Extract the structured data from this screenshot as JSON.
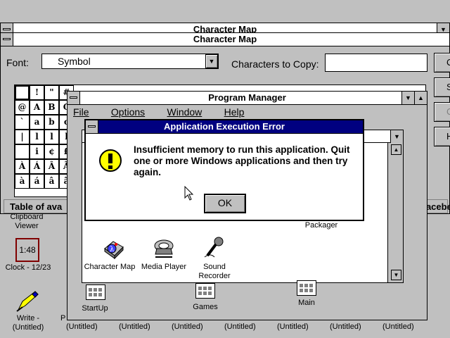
{
  "desktop": {
    "bottom_labels": [
      "(Untitled)",
      "(Untitled)",
      "(Untitled)",
      "(Untitled)",
      "(Untitled)",
      "(Untitled)",
      "(Untitled)"
    ],
    "clipboard": "Clipboard\nViewer",
    "clock_face": "1:48",
    "clock_label": "Clock - 12/23",
    "write_label": "Write -\n(Untitled)",
    "edge_label": "P"
  },
  "background_window": {
    "title": "Character Map"
  },
  "charmap": {
    "title": "Character Map",
    "font_label": "Font:",
    "font_value": "Symbol",
    "copy_label": "Characters to Copy:",
    "copy_value": "",
    "grid_chars": [
      [
        "",
        "!",
        "\"",
        "#"
      ],
      [
        "@",
        "A",
        "B",
        "C"
      ],
      [
        "`",
        "a",
        "b",
        "c"
      ],
      [
        "|",
        "l",
        "l",
        "l"
      ],
      [
        "",
        "i",
        "¢",
        "£"
      ],
      [
        "À",
        "Á",
        "Â",
        "Ã"
      ],
      [
        "à",
        "á",
        "â",
        "ã"
      ]
    ],
    "status_text": "Table of ava",
    "status_right": "pacebe",
    "side_buttons": [
      "C",
      "S",
      "C",
      "H"
    ]
  },
  "progman": {
    "title": "Program Manager",
    "menu": [
      {
        "label": "File"
      },
      {
        "label": "Options"
      },
      {
        "label": "Window"
      },
      {
        "label": "Help"
      }
    ],
    "icons": [
      {
        "label": "Character Map"
      },
      {
        "label": "Media Player"
      },
      {
        "label": "Sound\nRecorder"
      },
      {
        "label": "Packager"
      }
    ],
    "groups": [
      {
        "label": "StartUp"
      },
      {
        "label": "Games"
      },
      {
        "label": "Main"
      }
    ]
  },
  "dialog": {
    "title": "Application Execution Error",
    "message": "Insufficient memory to run this application. Quit one or more Windows applications and then try again.",
    "ok_label": "OK"
  },
  "colors": {
    "active_title": "#000080",
    "desktop": "#c0c0c0",
    "warning_icon": "#ffff00"
  }
}
